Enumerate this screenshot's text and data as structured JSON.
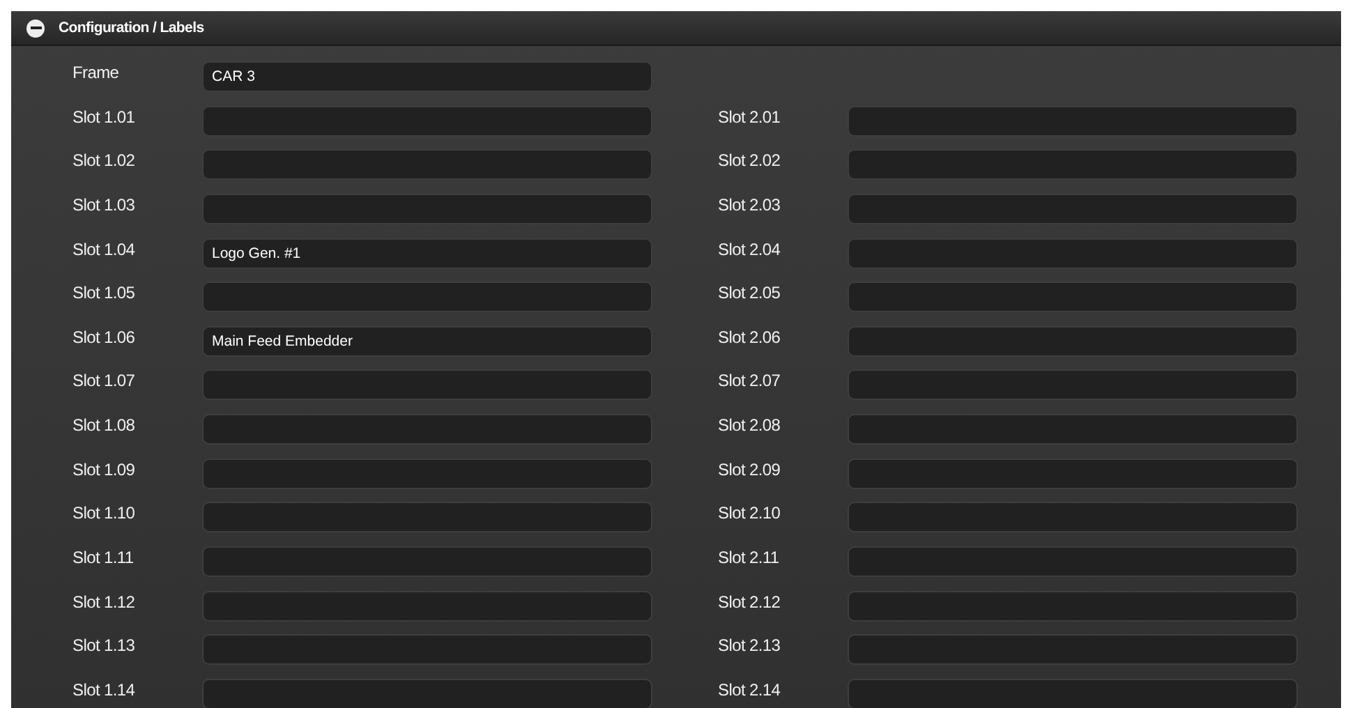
{
  "panel": {
    "title": "Configuration / Labels",
    "expanded": true
  },
  "frame": {
    "label": "Frame",
    "value": "CAR 3"
  },
  "rows": [
    {
      "left": {
        "label": "Slot 1.01"
      },
      "right": {
        "label": "Slot 2.01"
      }
    },
    {
      "left": {
        "label": "Slot 1.02"
      },
      "right": {
        "label": "Slot 2.02"
      }
    },
    {
      "left": {
        "label": "Slot 1.03"
      },
      "right": {
        "label": "Slot 2.03"
      }
    },
    {
      "left": {
        "label": "Slot 1.04",
        "value": "Logo Gen. #1"
      },
      "right": {
        "label": "Slot 2.04"
      }
    },
    {
      "left": {
        "label": "Slot 1.05"
      },
      "right": {
        "label": "Slot 2.05"
      }
    },
    {
      "left": {
        "label": "Slot 1.06",
        "value": "Main Feed Embedder"
      },
      "right": {
        "label": "Slot 2.06"
      }
    },
    {
      "left": {
        "label": "Slot 1.07"
      },
      "right": {
        "label": "Slot 2.07"
      }
    },
    {
      "left": {
        "label": "Slot 1.08"
      },
      "right": {
        "label": "Slot 2.08"
      }
    },
    {
      "left": {
        "label": "Slot 1.09"
      },
      "right": {
        "label": "Slot 2.09"
      }
    },
    {
      "left": {
        "label": "Slot 1.10"
      },
      "right": {
        "label": "Slot 2.10"
      }
    },
    {
      "left": {
        "label": "Slot 1.11"
      },
      "right": {
        "label": "Slot 2.11"
      }
    },
    {
      "left": {
        "label": "Slot 1.12"
      },
      "right": {
        "label": "Slot 2.12"
      }
    },
    {
      "left": {
        "label": "Slot 1.13"
      },
      "right": {
        "label": "Slot 2.13"
      }
    },
    {
      "left": {
        "label": "Slot 1.14"
      },
      "right": {
        "label": "Slot 2.14"
      }
    }
  ]
}
